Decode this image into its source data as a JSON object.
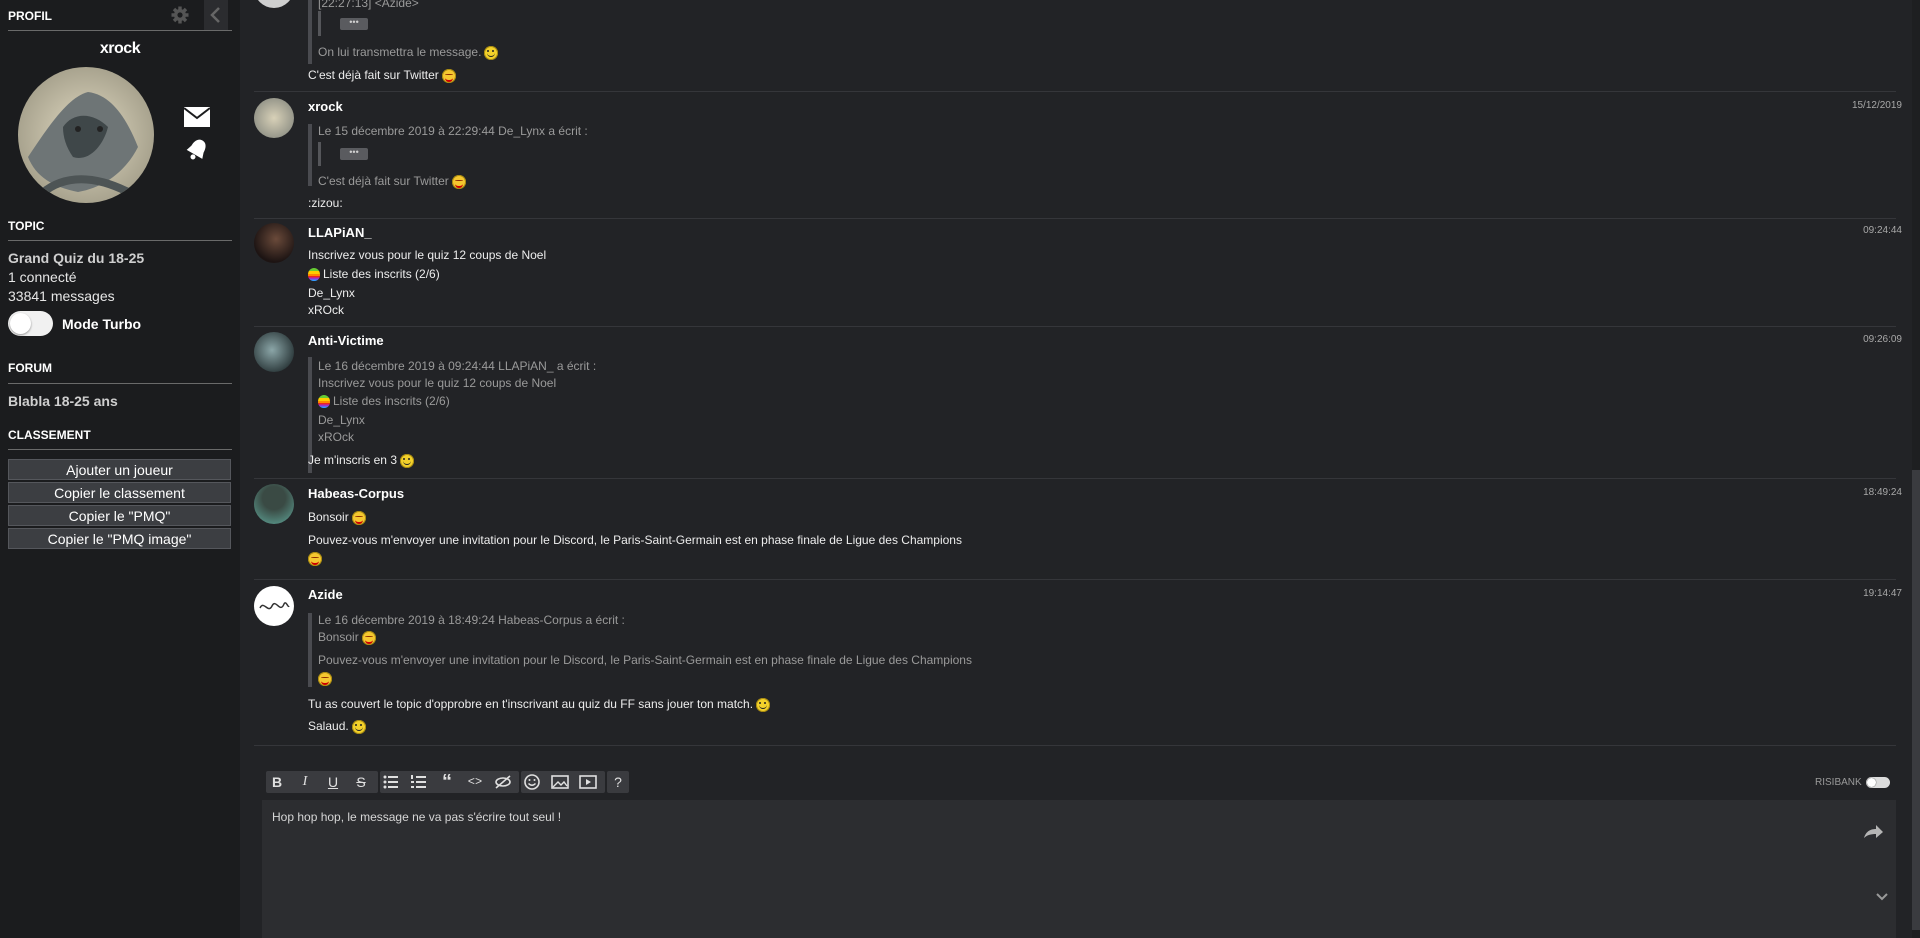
{
  "sidebar": {
    "profile_header": "PROFIL",
    "username": "xrock",
    "topic_header": "TOPIC",
    "topic_title": "Grand Quiz du 18-25",
    "connected": "1 connecté",
    "message_count": "33841 messages",
    "turbo_label": "Mode Turbo",
    "forum_header": "FORUM",
    "forum_name": "Blabla 18-25 ans",
    "ranking_header": "CLASSEMENT",
    "buttons": [
      "Ajouter un joueur",
      "Copier le classement",
      "Copier le \"PMQ\"",
      "Copier le \"PMQ image\""
    ]
  },
  "messages": [
    {
      "quote_lines": [
        "[22:27:13] <Azide>",
        "On lui transmettra le message."
      ],
      "text": "C'est déjà fait sur Twitter"
    },
    {
      "author": "xrock",
      "date": "15/12/2019",
      "quote_lines": [
        "Le 15 décembre 2019 à 22:29:44 De_Lynx a écrit :",
        "C'est déjà fait sur Twitter"
      ],
      "text": ":zizou:"
    },
    {
      "author": "LLAPiAN_",
      "date": "09:24:44",
      "lines": [
        "Inscrivez vous pour le quiz 12 coups de Noel",
        "Liste des inscrits (2/6)",
        "De_Lynx",
        "xROck"
      ]
    },
    {
      "author": "Anti-Victime",
      "date": "09:26:09",
      "quote_lines": [
        "Le 16 décembre 2019 à 09:24:44 LLAPiAN_ a écrit :",
        "Inscrivez vous pour le quiz 12 coups de Noel",
        "Liste des inscrits (2/6)",
        "De_Lynx",
        "xROck"
      ],
      "text": "Je m'inscris en 3"
    },
    {
      "author": "Habeas-Corpus",
      "date": "18:49:24",
      "lines": [
        "Bonsoir",
        "Pouvez-vous m'envoyer une invitation pour le Discord, le Paris-Saint-Germain est en phase finale de Ligue des Champions"
      ]
    },
    {
      "author": "Azide",
      "date": "19:14:47",
      "quote_lines": [
        "Le 16 décembre 2019 à 18:49:24 Habeas-Corpus a écrit :",
        "Bonsoir",
        "Pouvez-vous m'envoyer une invitation pour le Discord, le Paris-Saint-Germain est en phase finale de Ligue des Champions"
      ],
      "lines": [
        "Tu as couvert le topic d'opprobre en t'inscrivant au quiz du FF sans jouer ton match.",
        "Salaud."
      ]
    }
  ],
  "editor": {
    "risibank_label": "RISIBANK",
    "placeholder": "Hop hop hop, le message ne va pas s'écrire tout seul !",
    "toolbar_icons": [
      "bold-icon",
      "italic-icon",
      "underline-icon",
      "strike-icon",
      "bullet-list-icon",
      "numbered-list-icon",
      "quote-icon",
      "code-icon",
      "spoiler-icon",
      "smiley-icon",
      "image-icon",
      "video-icon",
      "help-icon"
    ],
    "toolbar_labels": {
      "bold": "B",
      "italic": "I",
      "underline": "U",
      "strike": "S",
      "help": "?"
    }
  },
  "colors": {
    "background": "#222326",
    "sidebar": "#1b1c1e",
    "button": "#3c3e42"
  }
}
